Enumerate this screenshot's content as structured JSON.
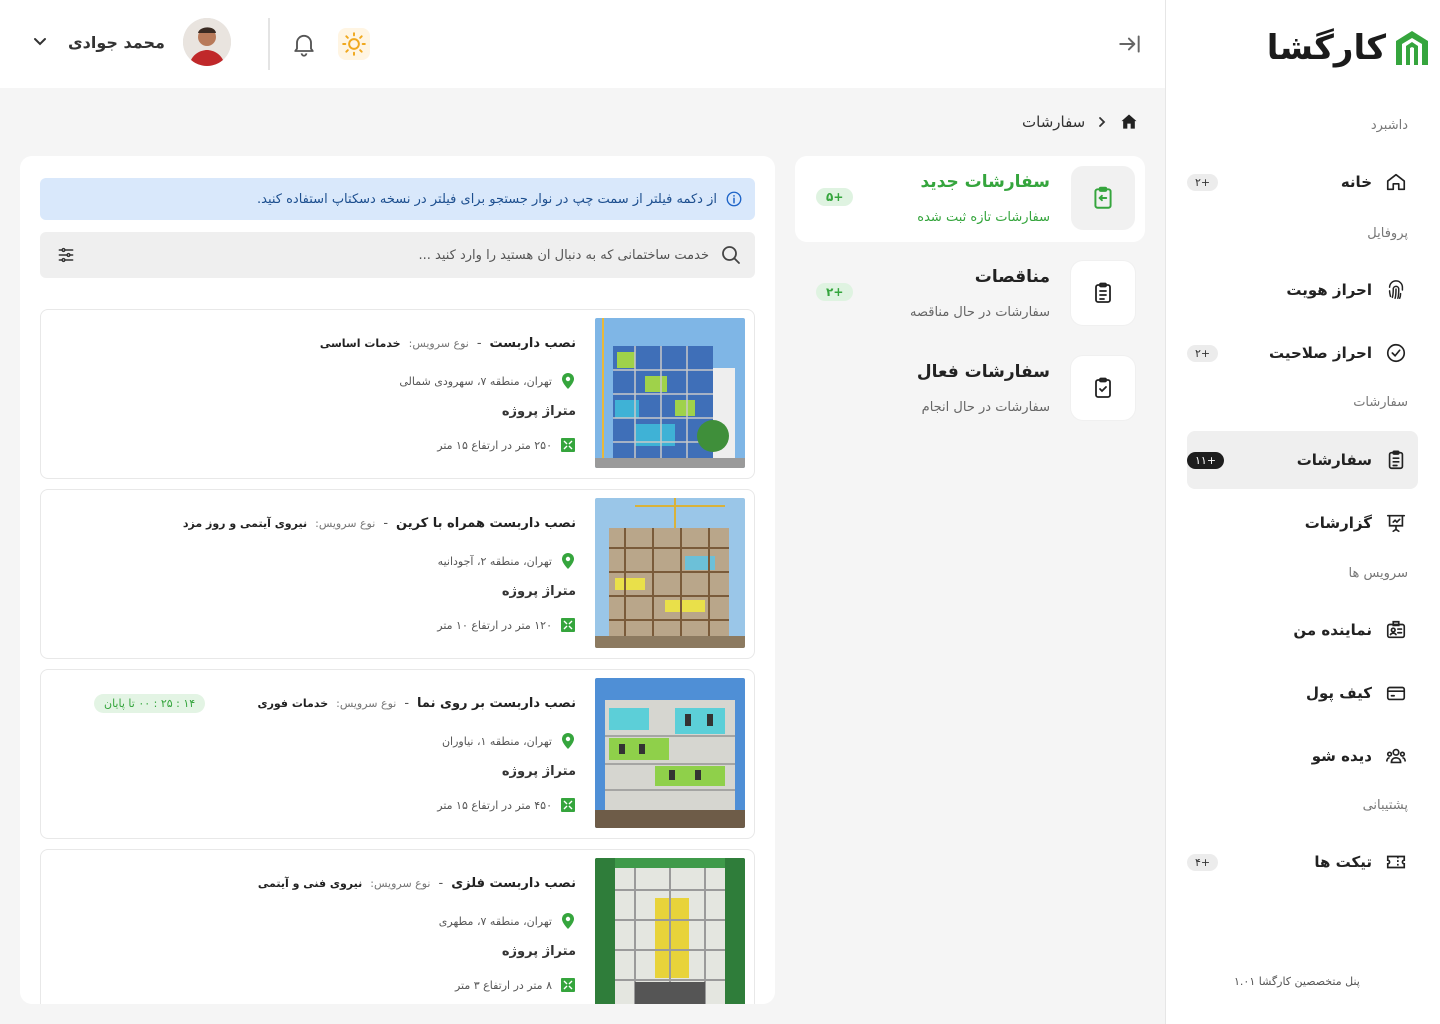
{
  "brand": {
    "name": "کارگشا"
  },
  "header": {
    "user_name": "محمد جوادی",
    "collapse_icon": "collapse-sidebar-icon",
    "bell_icon": "bell-icon",
    "theme_icon": "sun-icon"
  },
  "sidebar": {
    "sections": {
      "dashboard": "داشبرد",
      "profile": "پروفایل",
      "orders": "سفارشات",
      "services": "سرویس ها",
      "support": "پشتیبانی"
    },
    "items": [
      {
        "label": "خانه",
        "icon": "home-icon",
        "badge": "+۲"
      },
      {
        "label": "احراز هویت",
        "icon": "fingerprint-icon",
        "badge": ""
      },
      {
        "label": "احراز صلاحیت",
        "icon": "check-circle-icon",
        "badge": "+۲"
      },
      {
        "label": "سفارشات",
        "icon": "clipboard-icon",
        "badge": "+۱۱",
        "active": true
      },
      {
        "label": "گزارشات",
        "icon": "presentation-chart-icon",
        "badge": ""
      },
      {
        "label": "نماینده من",
        "icon": "id-card-icon",
        "badge": ""
      },
      {
        "label": "کیف پول",
        "icon": "wallet-icon",
        "badge": ""
      },
      {
        "label": "دیده شو",
        "icon": "users-icon",
        "badge": ""
      },
      {
        "label": "تیکت ها",
        "icon": "ticket-icon",
        "badge": "+۴"
      }
    ],
    "footer": "پنل متخصصین کارگشا ۱.۰۱"
  },
  "breadcrumb": {
    "current": "سفارشات",
    "home_icon": "home-filled-icon"
  },
  "status_cards": [
    {
      "title": "سفارشات جدید",
      "subtitle": "سفارشات تازه ثبت شده",
      "count": "+۵",
      "icon": "clipboard-import-icon",
      "active": true
    },
    {
      "title": "مناقصات",
      "subtitle": "سفارشات در حال مناقصه",
      "count": "+۲",
      "icon": "clipboard-list-icon",
      "active": false
    },
    {
      "title": "سفارشات فعال",
      "subtitle": "سفارشات در حال انجام",
      "count": "",
      "icon": "clipboard-check-icon",
      "active": false
    }
  ],
  "info_banner": "از دکمه فیلتر از سمت چپ در نوار جستجو برای فیلتر در نسخه دسکتاپ استفاده کنید.",
  "search": {
    "placeholder": "خدمت ساختمانی که به دنبال آن هستید را وارد کنید ..."
  },
  "service_type_label": "نوع سرویس:",
  "area_label": "متراژ پروژه",
  "orders": [
    {
      "title": "نصب داربست",
      "service_type": "خدمات اساسی",
      "location": "تهران، منطقه ۷، سهرودی شمالی",
      "dimension": "۲۵۰ متر در ارتفاع ۱۵ متر",
      "timer": ""
    },
    {
      "title": "نصب داربست همراه با کرین",
      "service_type": "نیروی آیتمی و روز مزد",
      "location": "تهران، منطقه ۲، آجودانیه",
      "dimension": "۱۲۰ متر در ارتفاع ۱۰ متر",
      "timer": ""
    },
    {
      "title": "نصب داربست بر روی نما",
      "service_type": "خدمات فوری",
      "location": "تهران، منطقه ۱، نیاوران",
      "dimension": "۴۵۰ متر در ارتفاع ۱۵ متر",
      "timer": "۱۴ : ۲۵ : ۰۰ تا پایان"
    },
    {
      "title": "نصب داربست فلزی",
      "service_type": "نیروی فنی و آیتمی",
      "location": "تهران، منطقه ۷، مطهری",
      "dimension": "۸ متر در ارتفاع ۳ متر",
      "timer": ""
    }
  ],
  "colors": {
    "accent_green": "#35a53d",
    "info_bg": "#d9e8fb",
    "info_text": "#1d4f8f"
  }
}
